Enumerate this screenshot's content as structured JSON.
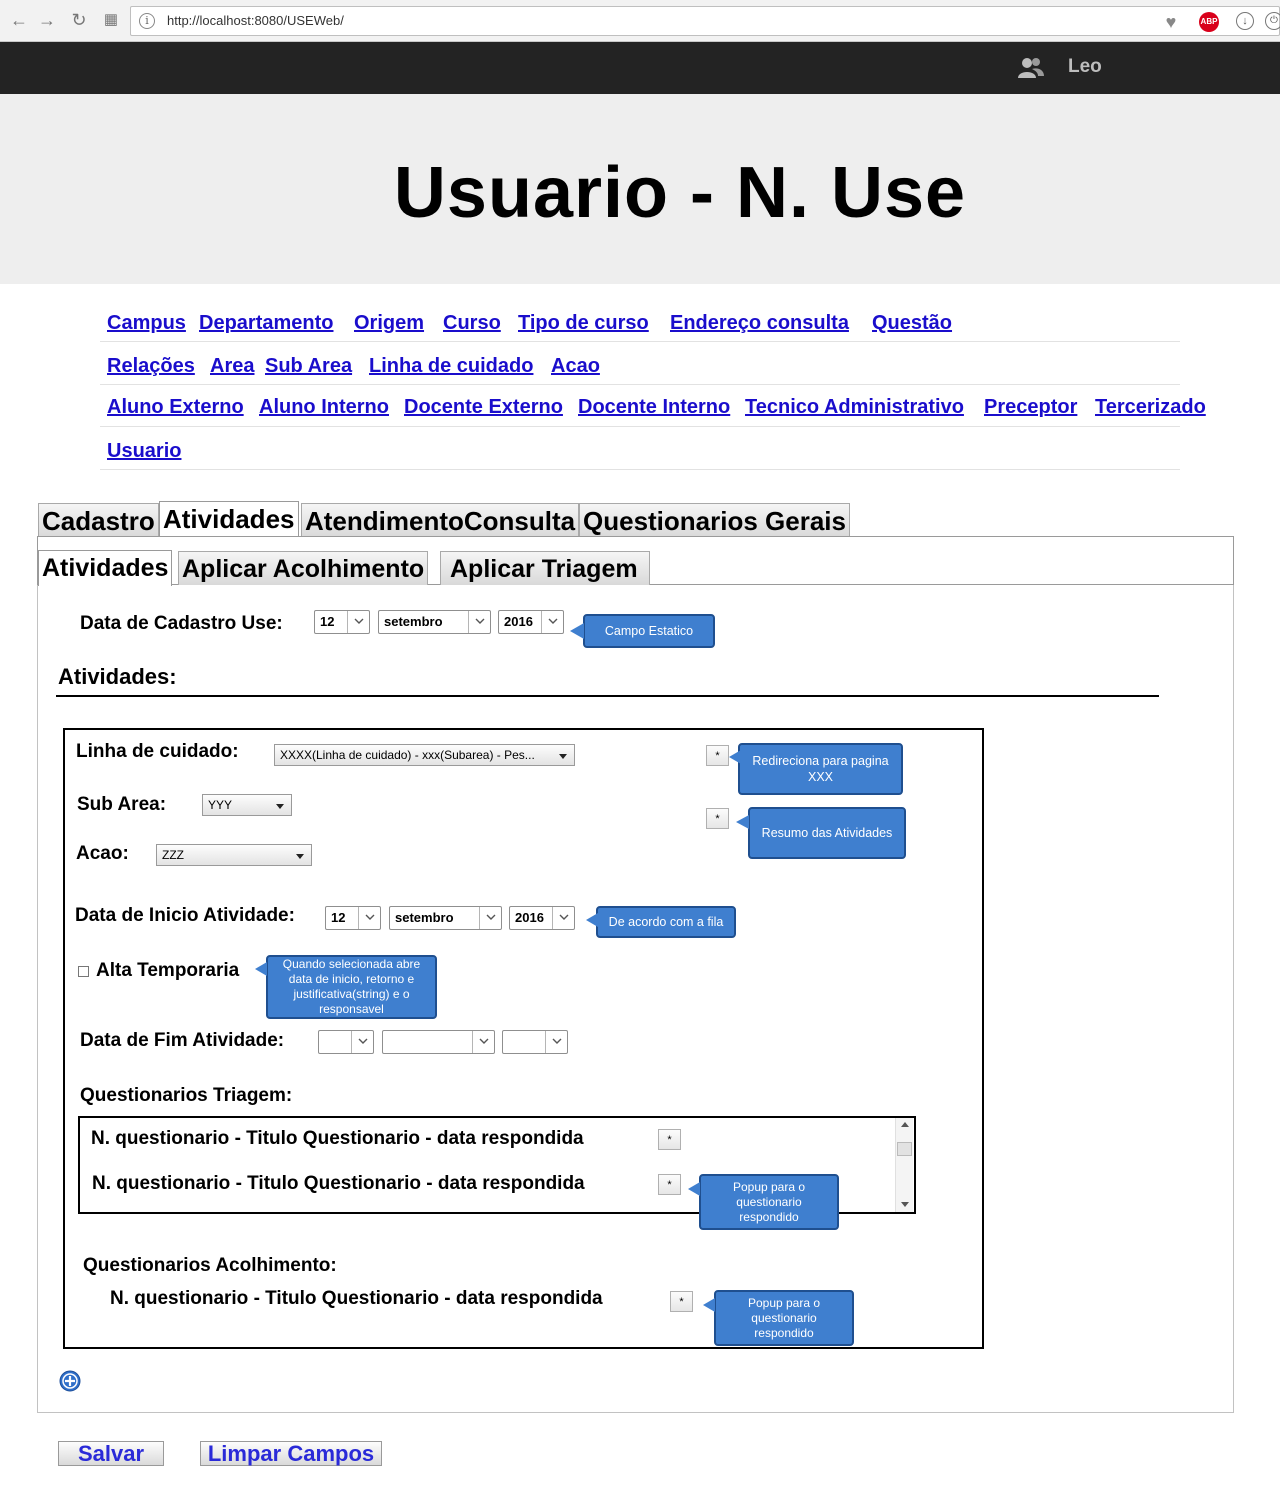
{
  "browser": {
    "url": "http://localhost:8080/USEWeb/",
    "abp_label": "ABP"
  },
  "header": {
    "user_name": "Leo",
    "title": "Usuario - N. Use"
  },
  "nav": {
    "campus": "Campus",
    "departamento": "Departamento",
    "origem": "Origem",
    "curso": "Curso",
    "tipo_de_curso": "Tipo de curso",
    "endereco_consulta": "Endereço consulta",
    "questao": "Questão",
    "relacoes": "Relações",
    "area": "Area",
    "sub_area": "Sub Area",
    "linha_de_cuidado": "Linha de cuidado",
    "acao": "Acao",
    "aluno_externo": "Aluno Externo",
    "aluno_interno": "Aluno Interno",
    "docente_externo": "Docente Externo",
    "docente_interno": "Docente Interno",
    "tecnico_administrativo": "Tecnico Administrativo",
    "preceptor": "Preceptor",
    "tercerizado": "Tercerizado",
    "usuario": "Usuario"
  },
  "tabs": {
    "cadastro": "Cadastro",
    "atividades": "Atividades",
    "atendimento": "AtendimentoConsulta",
    "questionarios_gerais": "Questionarios Gerais"
  },
  "subtabs": {
    "atividades": "Atividades",
    "aplicar_acolhimento": "Aplicar Acolhimento",
    "aplicar_triagem": "Aplicar Triagem"
  },
  "form": {
    "data_cadastro_label": "Data de Cadastro Use:",
    "data_cadastro": {
      "day": "12",
      "month": "setembro",
      "year": "2016"
    },
    "campo_estatico_note": "Campo Estatico",
    "section_title": "Atividades:",
    "linha_label": "Linha de cuidado:",
    "linha_value": "XXXX(Linha de cuidado) - xxx(Subarea) - Pes...",
    "sub_area_label": "Sub Area:",
    "sub_area_value": "YYY",
    "acao_label": "Acao:",
    "acao_value": "ZZZ",
    "star": "*",
    "redireciona_note": "Redireciona para pagina XXX",
    "resumo_note": "Resumo das Atividades",
    "data_inicio_label": "Data de Inicio Atividade:",
    "data_inicio": {
      "day": "12",
      "month": "setembro",
      "year": "2016"
    },
    "fila_note": "De acordo com a fila",
    "alta_label": "Alta Temporaria",
    "alta_note": "Quando selecionada abre data de inicio, retorno e justificativa(string) e o responsavel",
    "data_fim_label": "Data de Fim Atividade:",
    "triagem_label": "Questionarios Triagem:",
    "triagem_items": [
      "N. questionario - Titulo Questionario - data respondida",
      "N. questionario - Titulo Questionario - data respondida"
    ],
    "popup_note": "Popup para o questionario respondido",
    "acolhimento_label": "Questionarios Acolhimento:",
    "acolhimento_item": "N. questionario - Titulo Questionario - data respondida",
    "popup_note_2": "Popup para o questionario respondido"
  },
  "buttons": {
    "salvar": "Salvar",
    "limpar": "Limpar Campos"
  },
  "colors": {
    "callout_fill": "#3f7fcf",
    "link": "#1a0dcc",
    "topbar": "#232323"
  }
}
